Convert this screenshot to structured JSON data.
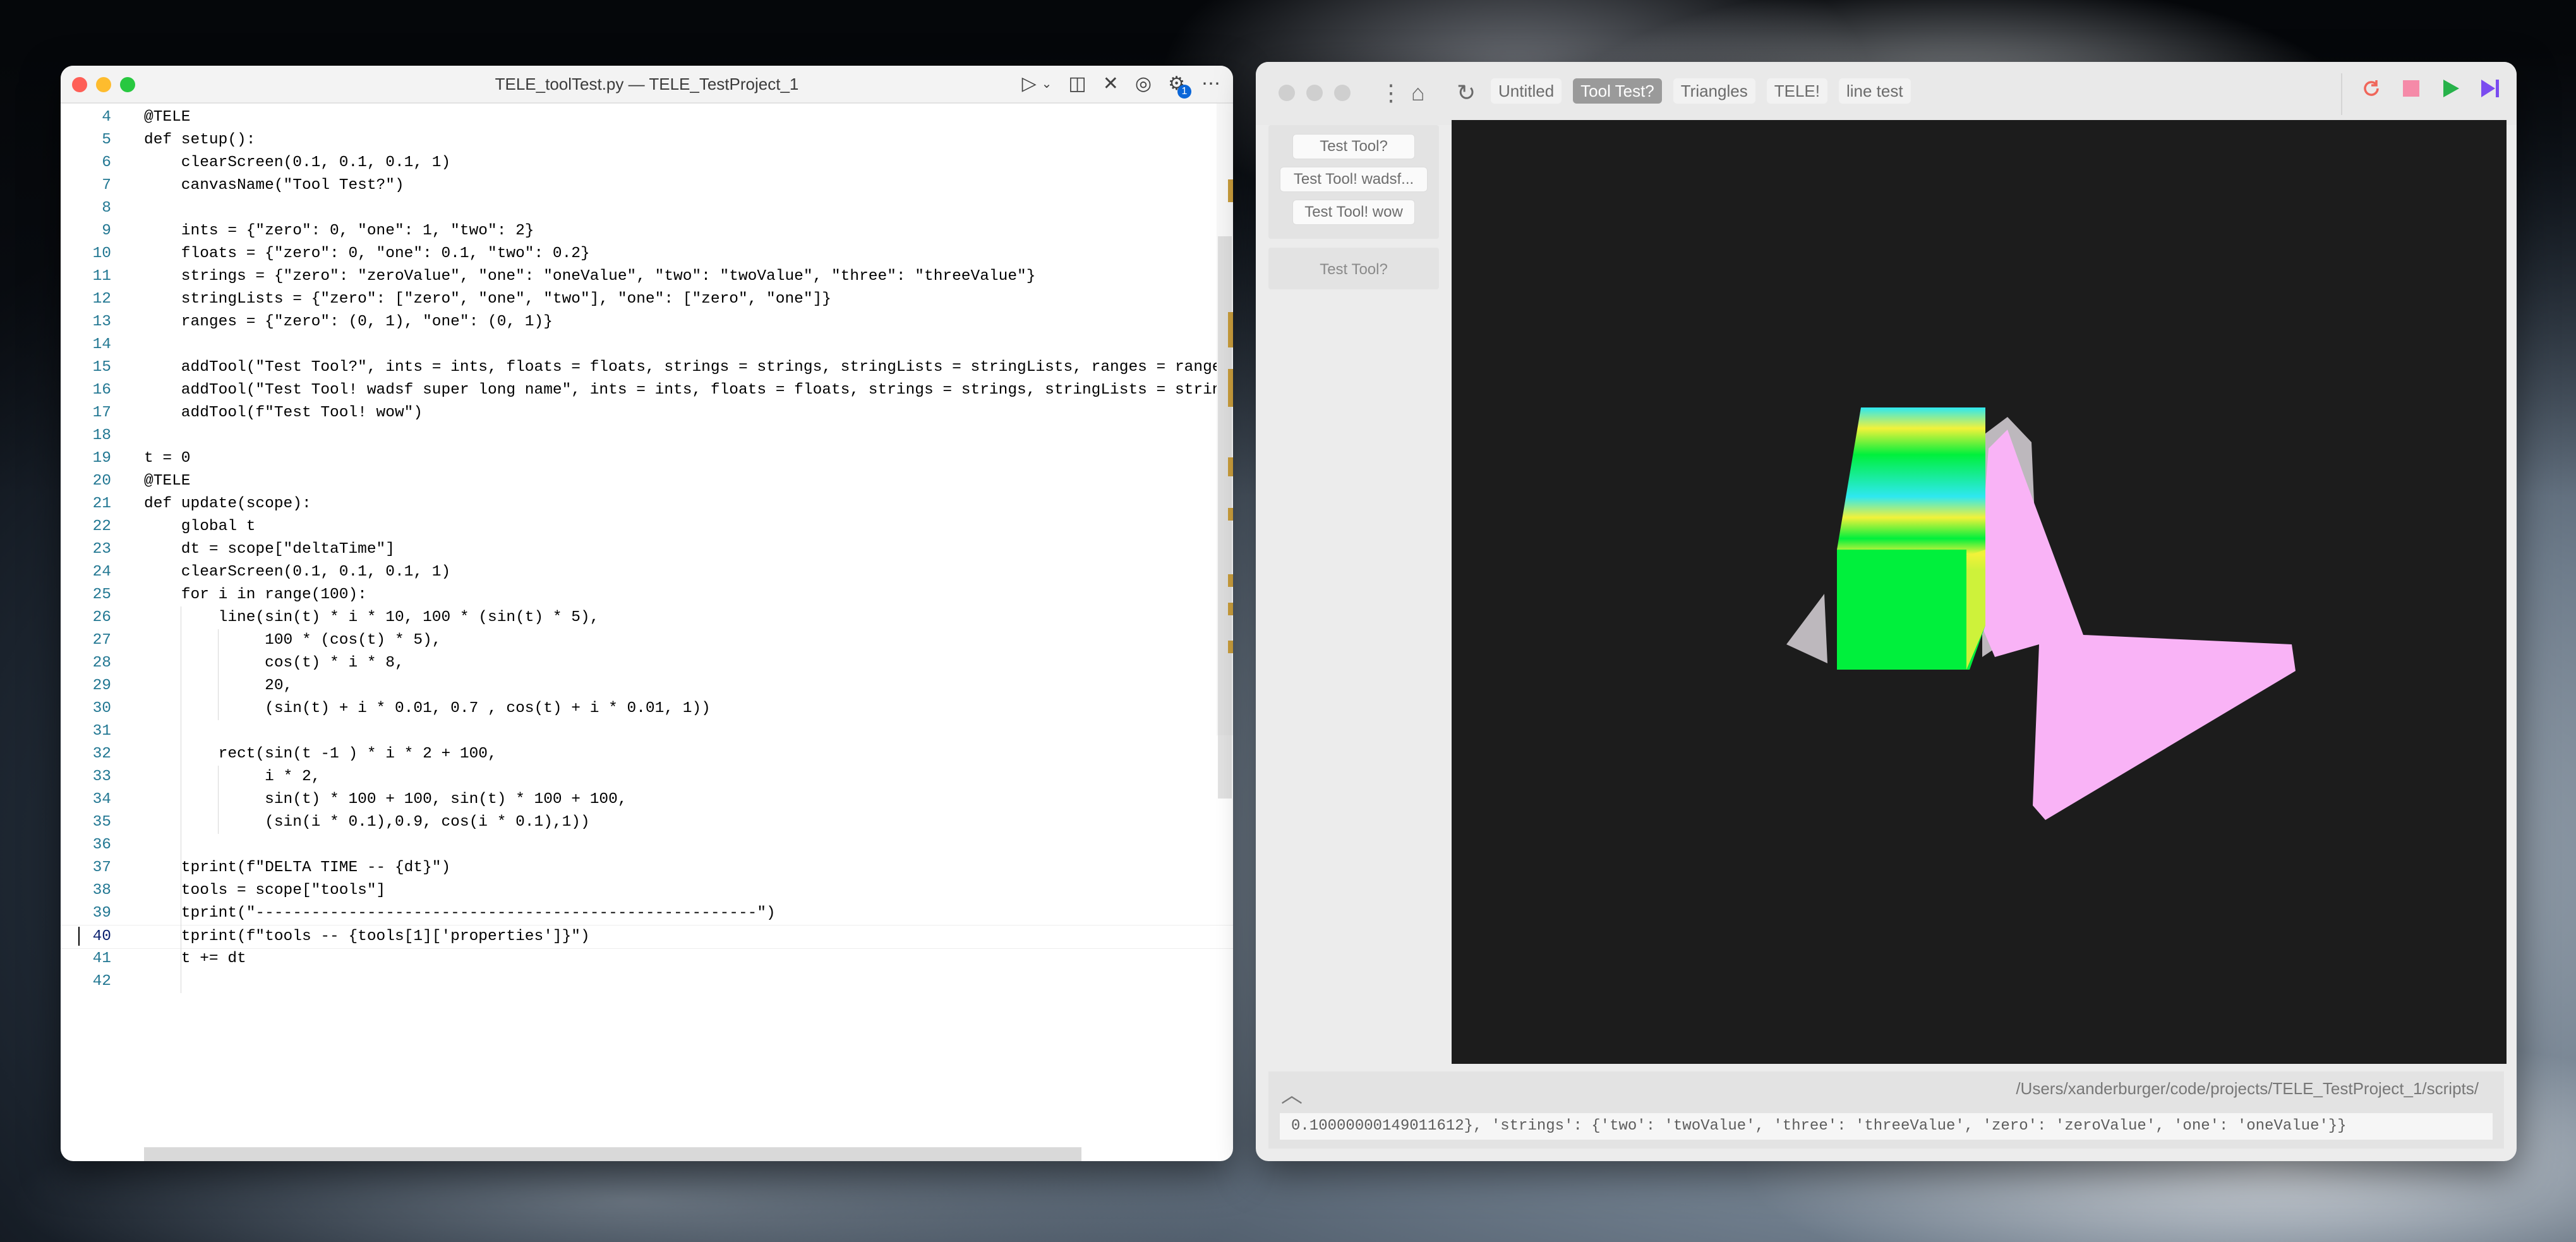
{
  "editor": {
    "title": "TELE_toolTest.py — TELE_TestProject_1",
    "settings_badge": "1",
    "cursor_line": 40
  },
  "code_lines": [
    {
      "n": "4",
      "t": "@TELE"
    },
    {
      "n": "5",
      "t": "def setup():"
    },
    {
      "n": "6",
      "t": "    clearScreen(0.1, 0.1, 0.1, 1)"
    },
    {
      "n": "7",
      "t": "    canvasName(\"Tool Test?\")"
    },
    {
      "n": "8",
      "t": ""
    },
    {
      "n": "9",
      "t": "    ints = {\"zero\": 0, \"one\": 1, \"two\": 2}"
    },
    {
      "n": "10",
      "t": "    floats = {\"zero\": 0, \"one\": 0.1, \"two\": 0.2}"
    },
    {
      "n": "11",
      "t": "    strings = {\"zero\": \"zeroValue\", \"one\": \"oneValue\", \"two\": \"twoValue\", \"three\": \"threeValue\"}"
    },
    {
      "n": "12",
      "t": "    stringLists = {\"zero\": [\"zero\", \"one\", \"two\"], \"one\": [\"zero\", \"one\"]}"
    },
    {
      "n": "13",
      "t": "    ranges = {\"zero\": (0, 1), \"one\": (0, 1)}"
    },
    {
      "n": "14",
      "t": ""
    },
    {
      "n": "15",
      "t": "    addTool(\"Test Tool?\", ints = ints, floats = floats, strings = strings, stringLists = stringLists, ranges = ranges)"
    },
    {
      "n": "16",
      "t": "    addTool(\"Test Tool! wadsf super long name\", ints = ints, floats = floats, strings = strings, stringLists = stringLi"
    },
    {
      "n": "17",
      "t": "    addTool(f\"Test Tool! wow\")"
    },
    {
      "n": "18",
      "t": ""
    },
    {
      "n": "19",
      "t": "t = 0"
    },
    {
      "n": "20",
      "t": "@TELE"
    },
    {
      "n": "21",
      "t": "def update(scope):"
    },
    {
      "n": "22",
      "t": "    global t"
    },
    {
      "n": "23",
      "t": "    dt = scope[\"deltaTime\"]"
    },
    {
      "n": "24",
      "t": "    clearScreen(0.1, 0.1, 0.1, 1)"
    },
    {
      "n": "25",
      "t": "    for i in range(100):"
    },
    {
      "n": "26",
      "t": "        line(sin(t) * i * 10, 100 * (sin(t) * 5),"
    },
    {
      "n": "27",
      "t": "             100 * (cos(t) * 5),"
    },
    {
      "n": "28",
      "t": "             cos(t) * i * 8,"
    },
    {
      "n": "29",
      "t": "             20,"
    },
    {
      "n": "30",
      "t": "             (sin(t) + i * 0.01, 0.7 , cos(t) + i * 0.01, 1))"
    },
    {
      "n": "31",
      "t": ""
    },
    {
      "n": "32",
      "t": "        rect(sin(t -1 ) * i * 2 + 100,"
    },
    {
      "n": "33",
      "t": "             i * 2,"
    },
    {
      "n": "34",
      "t": "             sin(t) * 100 + 100, sin(t) * 100 + 100,"
    },
    {
      "n": "35",
      "t": "             (sin(i * 0.1),0.9, cos(i * 0.1),1))"
    },
    {
      "n": "36",
      "t": ""
    },
    {
      "n": "37",
      "t": "    tprint(f\"DELTA TIME -- {dt}\")"
    },
    {
      "n": "38",
      "t": "    tools = scope[\"tools\"]"
    },
    {
      "n": "39",
      "t": "    tprint(\"------------------------------------------------------\")"
    },
    {
      "n": "40",
      "t": "    tprint(f\"tools -- {tools[1]['properties']}\")"
    },
    {
      "n": "41",
      "t": "    t += dt"
    },
    {
      "n": "42",
      "t": ""
    }
  ],
  "app": {
    "tabs": [
      {
        "label": "Untitled",
        "active": false
      },
      {
        "label": "Tool Test?",
        "active": true
      },
      {
        "label": "Triangles",
        "active": false
      },
      {
        "label": "TELE!",
        "active": false
      },
      {
        "label": "line test",
        "active": false
      }
    ],
    "tools_group_1": [
      "Test Tool?",
      "Test Tool! wadsf...",
      "Test Tool! wow"
    ],
    "tools_group_2_label": "Test Tool?",
    "console_path": "/Users/xanderburger/code/projects/TELE_TestProject_1/scripts/",
    "console_output": "0.10000000149011612}, 'strings': {'two': 'twoValue', 'three': 'threeValue', 'zero': 'zeroValue', 'one': 'oneValue'}}"
  },
  "icons": {
    "run": "play-icon",
    "split": "split-editor-icon",
    "close": "close-icon",
    "account": "account-icon",
    "settings": "gear-icon",
    "more": "more-icon",
    "home": "home-icon",
    "reload": "reload-icon",
    "restart": "restart-icon",
    "stop": "stop-icon",
    "play": "play-icon",
    "step": "step-forward-icon",
    "chevron": "chevron-up-icon"
  },
  "colors": {
    "restart": "#f0665a",
    "stop": "#f58aa8",
    "play": "#27b24a",
    "step": "#7b4cf0",
    "canvas_bg": "#1c1c1c",
    "green_shape": "#00f03c",
    "pink_shape": "#f9b3f6",
    "gray_shape": "#bdb8bd",
    "cyan": "#2ee8f0",
    "yellow": "#f2f23a"
  }
}
